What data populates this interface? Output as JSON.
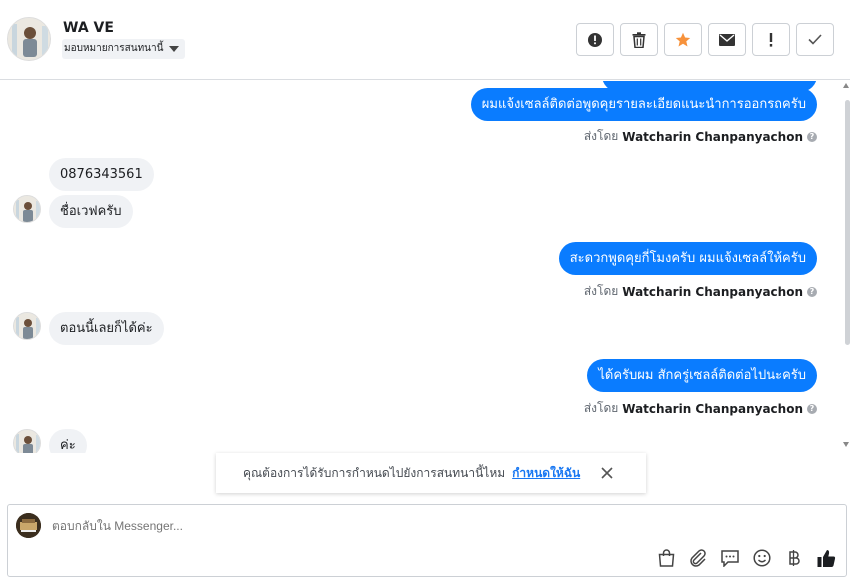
{
  "header": {
    "contact_name": "WA VE",
    "assign_label": "มอบหมายการสนทนานี้"
  },
  "toolbar": {
    "buttons": [
      {
        "icon": "alert-circle-icon"
      },
      {
        "icon": "trash-icon"
      },
      {
        "icon": "star-icon",
        "color": "#f7923b"
      },
      {
        "icon": "envelope-icon"
      },
      {
        "icon": "exclamation-icon"
      },
      {
        "icon": "check-icon"
      }
    ]
  },
  "messages": {
    "out_1": "ผมแจ้งเซลล์ติดต่อพูดคุยรายละเอียดแนะนำการออกรถครับ",
    "sent_by_label": "ส่งโดย",
    "sent_by_name": "Watcharin Chanpanyachon",
    "in_1": "0876343561",
    "in_2": "ชื่อเวฟครับ",
    "out_2": "สะดวกพูดคุยกี่โมงครับ ผมแจ้งเซลล์ให้ครับ",
    "in_3": "ตอนนี้เลยก็ได้ค่ะ",
    "out_3": "ได้ครับผม สักครู่เซลล์ติดต่อไปนะครับ",
    "in_4": "ค่ะ"
  },
  "notice": {
    "text": "คุณต้องการได้รับการกำหนดไปยังการสนทนานี้ไหม",
    "link": "กำหนดให้ฉัน"
  },
  "composer": {
    "placeholder": "ตอบกลับใน Messenger..."
  },
  "colors": {
    "outgoing_bubble": "#0a7cff",
    "incoming_bubble": "#f0f2f5",
    "link": "#1877f2"
  }
}
